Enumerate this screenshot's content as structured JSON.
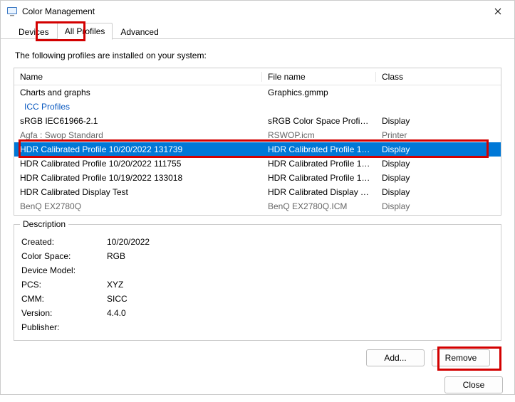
{
  "window": {
    "title": "Color Management"
  },
  "tabs": [
    {
      "label": "Devices",
      "active": false
    },
    {
      "label": "All Profiles",
      "active": true
    },
    {
      "label": "Advanced",
      "active": false
    }
  ],
  "intro": "The following profiles are installed on your system:",
  "columns": {
    "name": "Name",
    "file": "File name",
    "cls": "Class"
  },
  "rows": [
    {
      "name": "Charts and graphs",
      "file": "Graphics.gmmp",
      "cls": ""
    },
    {
      "name": "ICC Profiles",
      "file": "",
      "cls": "",
      "group": true
    },
    {
      "name": "sRGB IEC61966-2.1",
      "file": "sRGB Color Space Profile.ic...",
      "cls": "Display"
    },
    {
      "name": "Agfa : Swop Standard",
      "file": "RSWOP.icm",
      "cls": "Printer",
      "partial": true
    },
    {
      "name": "HDR Calibrated Profile 10/20/2022 131739",
      "file": "HDR Calibrated Profile 10-...",
      "cls": "Display",
      "selected": true
    },
    {
      "name": "HDR Calibrated Profile 10/20/2022 111755",
      "file": "HDR Calibrated Profile 10-...",
      "cls": "Display"
    },
    {
      "name": "HDR Calibrated Profile 10/19/2022 133018",
      "file": "HDR Calibrated Profile 10-...",
      "cls": "Display"
    },
    {
      "name": "HDR Calibrated Display Test",
      "file": "HDR Calibrated Display Tes...",
      "cls": "Display"
    },
    {
      "name": "BenQ EX2780Q",
      "file": "BenQ EX2780Q.ICM",
      "cls": "Display",
      "partial": true
    }
  ],
  "description": {
    "legend": "Description",
    "fields": [
      {
        "k": "Created:",
        "v": "10/20/2022"
      },
      {
        "k": "Color Space:",
        "v": "RGB"
      },
      {
        "k": "Device Model:",
        "v": ""
      },
      {
        "k": "PCS:",
        "v": "XYZ"
      },
      {
        "k": "CMM:",
        "v": "SICC"
      },
      {
        "k": "Version:",
        "v": "4.4.0"
      },
      {
        "k": "Publisher:",
        "v": ""
      }
    ]
  },
  "buttons": {
    "add": "Add...",
    "remove": "Remove",
    "close": "Close"
  }
}
